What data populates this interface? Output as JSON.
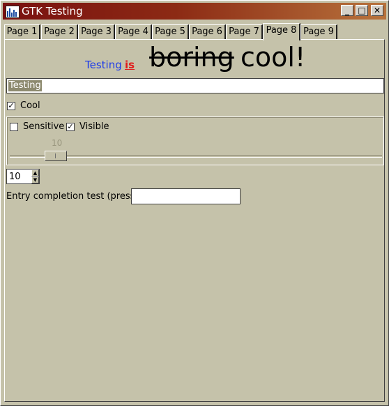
{
  "window": {
    "title": "GTK Testing",
    "controls": {
      "minimize": "_",
      "maximize": "□",
      "close": "✕"
    }
  },
  "tabs": [
    {
      "label": "Page 1",
      "active": false
    },
    {
      "label": "Page 2",
      "active": false
    },
    {
      "label": "Page 3",
      "active": false
    },
    {
      "label": "Page 4",
      "active": false
    },
    {
      "label": "Page 5",
      "active": false
    },
    {
      "label": "Page 6",
      "active": false
    },
    {
      "label": "Page 7",
      "active": false
    },
    {
      "label": "Page 8",
      "active": true
    },
    {
      "label": "Page 9",
      "active": false
    }
  ],
  "markup_label": {
    "part1": "Testing",
    "part2": "is",
    "part3": "boring",
    "part4": "cool!"
  },
  "main_entry": {
    "value": "Testing"
  },
  "cool_check": {
    "label": "Cool",
    "checked": true,
    "mark": "✓"
  },
  "frame": {
    "sensitive": {
      "label": "Sensitive",
      "checked": false
    },
    "visible": {
      "label": "Visible",
      "checked": true,
      "mark": "✓"
    },
    "scale": {
      "value": "10",
      "fraction": 0.1
    }
  },
  "spin": {
    "value": "10",
    "up": "▲",
    "down": "▼"
  },
  "completion": {
    "label": "Entry completion test (press i)",
    "value": ""
  },
  "colors": {
    "background": "#c5c2aa",
    "title_gradient_start": "#7a1010",
    "title_gradient_end": "#b8733c",
    "markup_blue": "#1f3ce8",
    "markup_red": "#e11a1a"
  }
}
